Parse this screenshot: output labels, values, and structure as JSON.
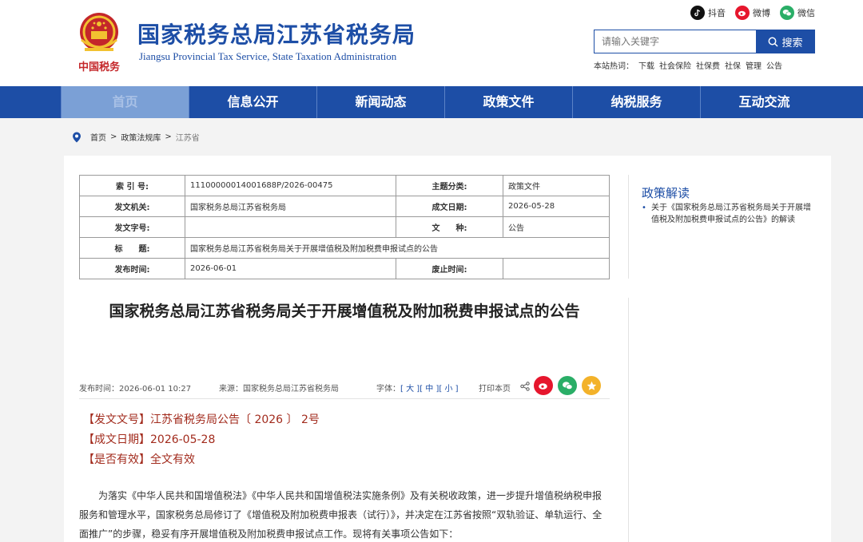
{
  "header": {
    "site_name_cn": "国家税务总局江苏省税务局",
    "site_name_en": "Jiangsu Provincial Tax Service, State Taxation Administration",
    "emblem_text": "中国税务",
    "social": [
      {
        "icon": "douyin-icon",
        "label": "抖音"
      },
      {
        "icon": "weibo-icon",
        "label": "微博"
      },
      {
        "icon": "wechat-icon",
        "label": "微信"
      }
    ],
    "search": {
      "placeholder": "请输入关键字",
      "button_label": "搜索"
    },
    "hotwords_label": "本站热词：",
    "hotwords": [
      "下载",
      "社会保险",
      "社保费",
      "社保",
      "管理",
      "公告"
    ]
  },
  "nav": {
    "items": [
      "首页",
      "信息公开",
      "新闻动态",
      "政策文件",
      "纳税服务",
      "互动交流"
    ],
    "active_index": 0
  },
  "breadcrumb": {
    "items": [
      "首页",
      "政策法规库",
      "江苏省"
    ],
    "separator": ">"
  },
  "meta_table": {
    "rows": [
      {
        "k1": "索 引 号:",
        "v1": "11100000014001688P/2026-00475",
        "k2": "主题分类:",
        "v2": "政策文件"
      },
      {
        "k1": "发文机关:",
        "v1": "国家税务总局江苏省税务局",
        "k2": "成文日期:",
        "v2": "2026-05-28"
      },
      {
        "k1": "发文字号:",
        "v1": "",
        "k2": "文　　种:",
        "v2": "公告"
      },
      {
        "k1": "标　　题:",
        "v1": "国家税务总局江苏省税务局关于开展增值税及附加税费申报试点的公告"
      },
      {
        "k1": "发布时间:",
        "v1": "2026-06-01",
        "k2": "废止时间:",
        "v2": ""
      }
    ]
  },
  "sidebar": {
    "title": "政策解读",
    "items": [
      "关于《国家税务总局江苏省税务局关于开展增值税及附加税费申报试点的公告》的解读"
    ]
  },
  "article": {
    "title": "国家税务总局江苏省税务局关于开展增值税及附加税费申报试点的公告",
    "publish_time": "发布时间：2026-06-01 10:27",
    "source": "来源：国家税务总局江苏省税务局",
    "font_label": "字体：",
    "font_sizes": [
      "大",
      "中",
      "小"
    ],
    "print_label": "打印本页",
    "doc_number": "【发文文号】江苏省税务局公告〔 2026 〕 2号",
    "doc_date": "【成文日期】2026-05-28",
    "doc_valid": "【是否有效】全文有效",
    "body": "为落实《中华人民共和国增值税法》《中华人民共和国增值税法实施条例》及有关税收政策，进一步提升增值税纳税申报服务和管理水平，国家税务总局修订了《增值税及附加税费申报表（试行）》，并决定在江苏省按照“双轨验证、单轨运行、全面推广”的步骤，稳妥有序开展增值税及附加税费申报试点工作。现将有关事项公告如下："
  },
  "colors": {
    "brand_blue": "#1d4ea6",
    "nav_active": "#7ba0d6",
    "doc_red": "#a22b1d",
    "weibo_red": "#e6162d",
    "wechat_green": "#2aae67",
    "favorite_yellow": "#f3b22a"
  }
}
